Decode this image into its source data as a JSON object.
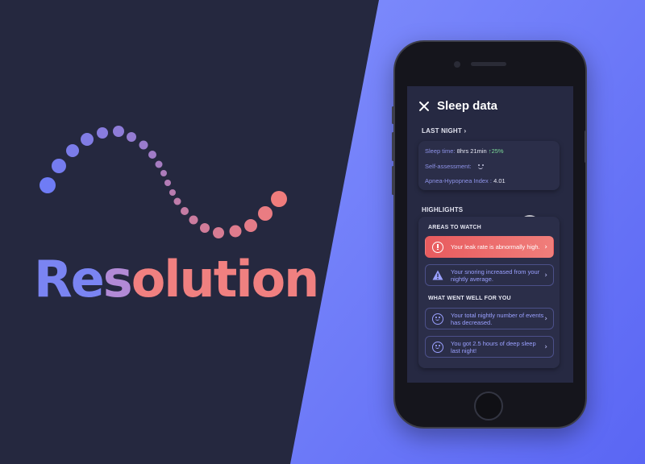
{
  "brand": {
    "wordmark_parts": [
      "Re",
      "s",
      "olution"
    ],
    "colors": {
      "dark_background": "#25283f",
      "light_background_start": "#5a66f4",
      "light_background_end": "#7f8dfc",
      "gradient_blue": "#6f7cf5",
      "gradient_pink": "#f07c7c"
    },
    "logo_icon": "dotted-wave-logo"
  },
  "app": {
    "title": "Sleep data",
    "close_icon": "close-icon",
    "last_night": {
      "label": "LAST NIGHT",
      "chevron": "›",
      "sleep_time_label": "Sleep time:",
      "sleep_time_value": "8hrs 21min",
      "sleep_time_delta": "↑25%",
      "self_assessment_label": "Self-assessment:",
      "self_assessment_icon": "smile-icon",
      "ahi_label": "Apnea-Hypopnea Index :",
      "ahi_value": "4.01"
    },
    "highlights": {
      "label": "HIGHLIGHTS",
      "areas_to_watch_label": "AREAS TO WATCH",
      "areas_to_watch": [
        {
          "text": "Your leak rate is abnormally high.",
          "icon": "alert-circle-icon",
          "severity": "alert"
        },
        {
          "text": "Your snoring increased from your nightly average.",
          "icon": "warning-icon",
          "severity": "normal"
        }
      ],
      "went_well_label": "WHAT WENT WELL FOR YOU",
      "went_well": [
        {
          "text": "Your total nightly number of events has decreased.",
          "icon": "happy-face-icon"
        },
        {
          "text": "You got 2.5 hours of deep sleep last night!",
          "icon": "happy-face-icon"
        }
      ],
      "item_arrow": "›"
    }
  }
}
